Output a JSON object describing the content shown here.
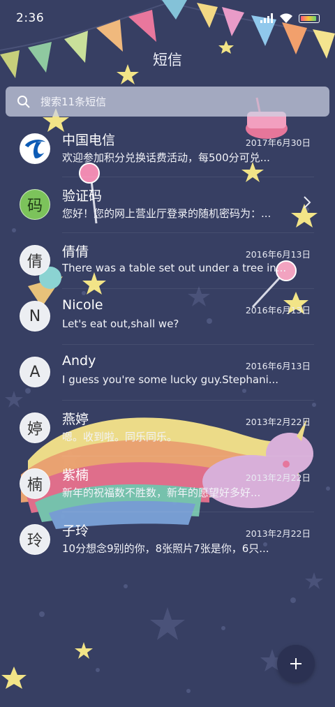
{
  "status_bar": {
    "time": "2:36"
  },
  "header": {
    "title": "短信"
  },
  "search": {
    "placeholder": "搜索11条短信"
  },
  "conversations": [
    {
      "name": "中国电信",
      "date": "2017年6月30日",
      "preview": "欢迎参加积分兑换话费活动，每500分可兑...",
      "avatar": ""
    },
    {
      "name": "验证码",
      "date": "",
      "preview": "您好！您的网上营业厅登录的随机密码为：...",
      "avatar": "码"
    },
    {
      "name": "倩倩",
      "date": "2016年6月13日",
      "preview": "There was a table set out under a tree in...",
      "avatar": "倩"
    },
    {
      "name": "Nicole",
      "date": "2016年6月13日",
      "preview": "Let's eat out,shall we?",
      "avatar": "N"
    },
    {
      "name": "Andy",
      "date": "2016年6月13日",
      "preview": "I guess you're some lucky guy.Stephani...",
      "avatar": "A"
    },
    {
      "name": "燕婷",
      "date": "2013年2月22日",
      "preview": "嗯。收到啦。同乐同乐。",
      "avatar": "婷"
    },
    {
      "name": "紫楠",
      "date": "2013年2月22日",
      "preview": "新年的祝福数不胜数，新年的愿望好多好...",
      "avatar": "楠"
    },
    {
      "name": "子玲",
      "date": "2013年2月22日",
      "preview": "10分想念9别的你，8张照片7张是你，6只...",
      "avatar": "玲"
    }
  ],
  "colors": {
    "background": "#373f63",
    "search_bg": "#cdd2e4",
    "fab_bg": "#2b3152",
    "verify_avatar": "#7cc35b"
  },
  "icons": {
    "search": "search-icon",
    "compose": "plus-icon",
    "chevron": "chevron-right-icon"
  }
}
